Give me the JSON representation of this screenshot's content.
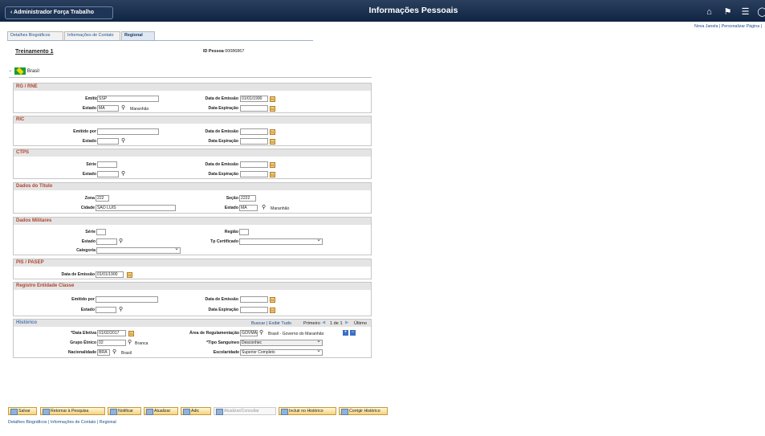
{
  "topbar": {
    "back": "Administrador Força Trabalho",
    "title": "Informações Pessoais"
  },
  "toplinks": {
    "text": "Nova Janela | Personalizar Página |"
  },
  "tabs": [
    "Detalhes Biográficos",
    "Informações de Contato",
    "Regional"
  ],
  "person": {
    "name": "Treinamento 1",
    "id_label": "ID Pessoa",
    "id_value": "00086867"
  },
  "country": {
    "label": "Brasil"
  },
  "sections": {
    "rg": {
      "title": "RG / RNE",
      "emitido": "SSP",
      "estado": "MA",
      "estado_desc": "Maranhão",
      "data_emissao": "01/01/1990",
      "data_exp": ""
    },
    "ric": {
      "title": "RIC"
    },
    "ctps": {
      "title": "CTPS"
    },
    "titulo": {
      "title": "Dados do Título",
      "zona": "222",
      "secao": "2222",
      "cidade": "SAO LUIS",
      "estado": "MA",
      "estado_desc": "Maranhão"
    },
    "militares": {
      "title": "Dados Militares"
    },
    "pis": {
      "title": "PIS / PASEP",
      "data": "01/01/1900"
    },
    "registro": {
      "title": "Registro Entidade Classe"
    }
  },
  "labels": {
    "emitido": "Emitido por",
    "estado": "Estado",
    "data_emissao": "Data de Emissão",
    "data_exp": "Data Expiração",
    "serie": "Série",
    "zona": "Zona",
    "secao": "Seção",
    "cidade": "Cidade",
    "regiao": "Região",
    "tp_cert": "Tp Certificado",
    "categoria": "Categoria",
    "pis_data": "Data de Emissão"
  },
  "historico": {
    "title": "Histórico",
    "nav": "Buscar | Exibir Tudo",
    "primeiro": "Primeiro",
    "pos": "1 de 1",
    "ultimo": "Último",
    "data_label": "*Data Efetiva",
    "data": "01/02/2017",
    "area_label": "Área de Regulamentação",
    "area": "GOVMA",
    "area_desc": "Brasil - Governo do Maranhão",
    "grupo_label": "Grupo Étnico",
    "grupo": "02",
    "grupo_desc": "Branca",
    "sang_label": "*Tipo Sanguíneo",
    "sang": "Desconhec",
    "nac_label": "Nacionalidade",
    "nac": "BRA",
    "nac_desc": "Brasil",
    "esc_label": "Escolaridade",
    "esc": "Superior Completo"
  },
  "buttons": [
    "Salvar",
    "Retornar à Pesquisa",
    "Notificar",
    "Atualizar",
    "Adic",
    "Atualizar/Consultar",
    "Incluir no Histórico",
    "Corrigir Histórico"
  ],
  "footer": [
    "Detalhes Biográficos",
    "Informações de Contato",
    "Regional"
  ]
}
